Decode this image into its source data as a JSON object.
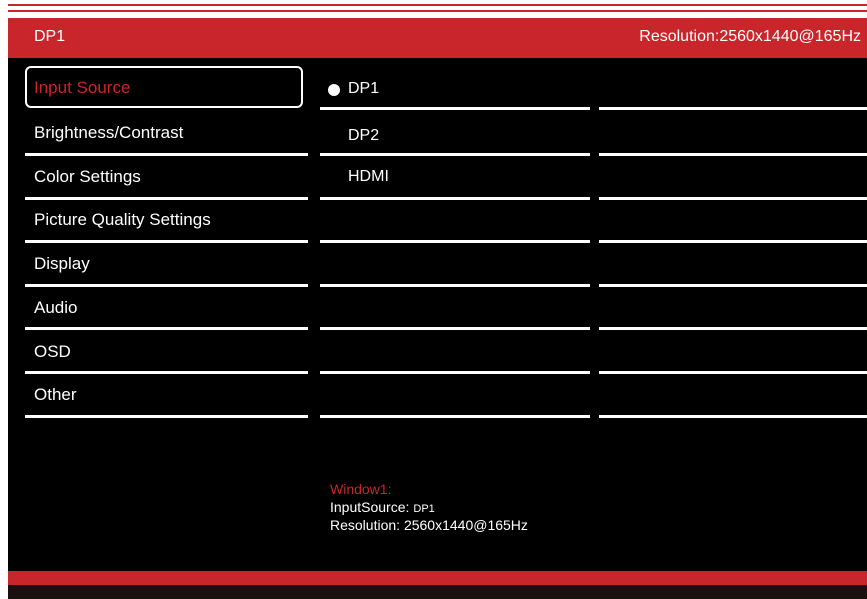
{
  "header": {
    "source": "DP1",
    "resolution_label": "Resolution:",
    "resolution_value": "2560x1440@165Hz"
  },
  "menu": {
    "items": [
      {
        "label": "Input Source"
      },
      {
        "label": "Brightness/Contrast"
      },
      {
        "label": "Color Settings"
      },
      {
        "label": "Picture Quality Settings"
      },
      {
        "label": "Display"
      },
      {
        "label": "Audio"
      },
      {
        "label": "OSD"
      },
      {
        "label": "Other"
      }
    ],
    "selected": "Input Source"
  },
  "options": {
    "items": [
      {
        "label": "DP1"
      },
      {
        "label": "DP2"
      },
      {
        "label": "HDMI"
      }
    ],
    "selected": "DP1"
  },
  "info": {
    "window_title": "Window1:",
    "input_label": "InputSource:",
    "input_value": "DP1",
    "resolution_label": "Resolution:",
    "resolution_value": "2560x1440@165Hz"
  },
  "colors": {
    "accent": "#c8262a",
    "background": "#000000",
    "text": "#ffffff"
  },
  "icons": {
    "selected_option": "radio-dot-icon"
  }
}
